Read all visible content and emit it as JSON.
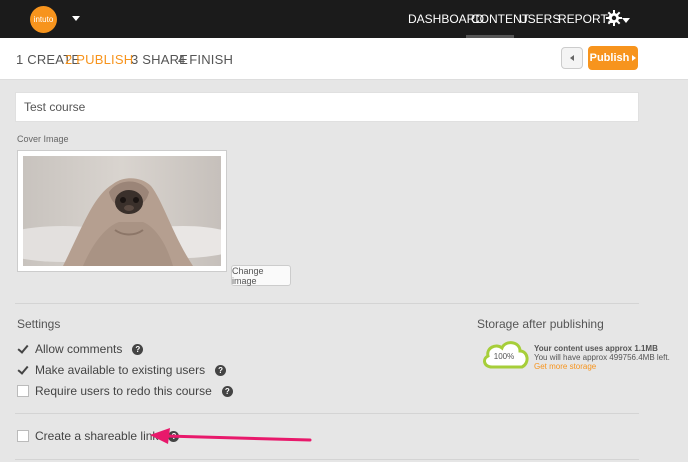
{
  "header": {
    "logo_text": "intuto",
    "nav": [
      "DASHBOARD",
      "CONTENT",
      "USERS",
      "REPORTS"
    ],
    "active_nav": "CONTENT"
  },
  "steps": [
    {
      "num": "1",
      "label": "CREATE"
    },
    {
      "num": "2",
      "label": "PUBLISH"
    },
    {
      "num": "3",
      "label": "SHARE"
    },
    {
      "num": "4",
      "label": "FINISH"
    }
  ],
  "active_step": "PUBLISH",
  "actions": {
    "publish_label": "Publish"
  },
  "course": {
    "title": "Test course",
    "cover_label": "Cover Image",
    "change_image_label": "Change image"
  },
  "settings": {
    "title": "Settings",
    "options": [
      {
        "label": "Allow comments",
        "checked": true
      },
      {
        "label": "Make available to existing users",
        "checked": true
      },
      {
        "label": "Require users to redo this course",
        "checked": false
      }
    ],
    "shareable": {
      "label": "Create a shareable link",
      "checked": false
    }
  },
  "storage": {
    "title": "Storage after publishing",
    "percent": "100%",
    "usage_text": "Your content uses approx 1.1MB",
    "remaining_text": "You will have approx 499756.4MB left.",
    "get_more": "Get more storage"
  },
  "colors": {
    "accent": "#f7941d",
    "cloud": "#a6ce39",
    "arrow": "#e8196b",
    "topbar": "#1b1b1b"
  }
}
